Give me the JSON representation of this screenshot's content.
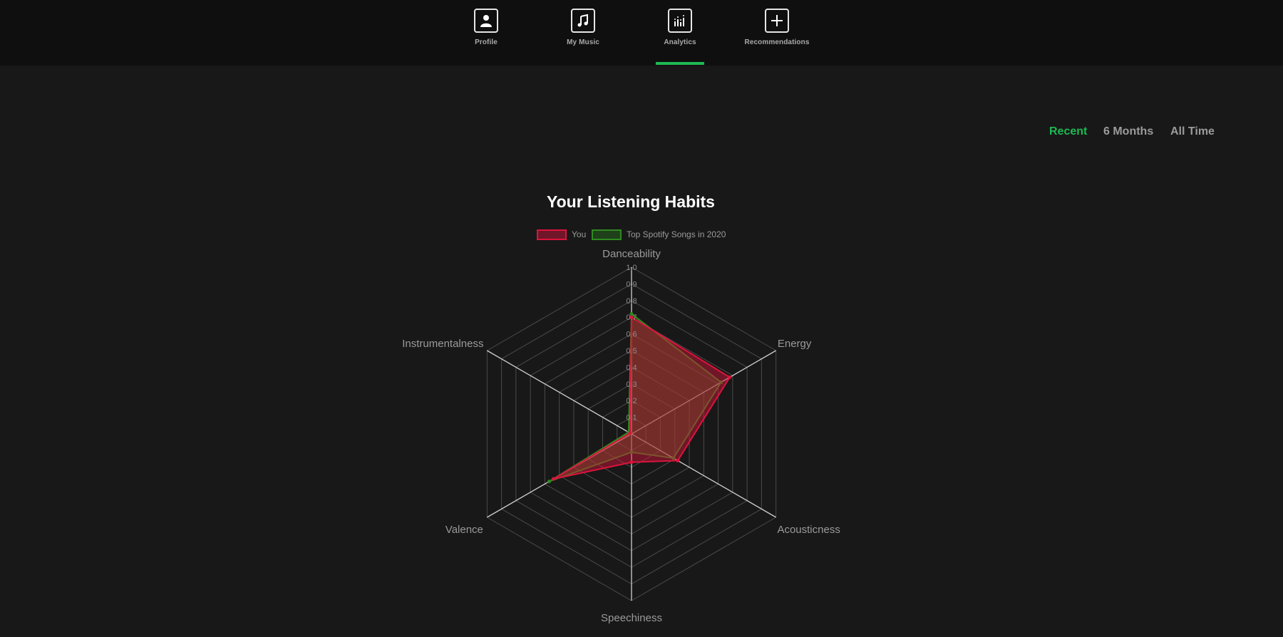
{
  "nav": {
    "items": [
      {
        "label": "Profile",
        "icon": "person-icon"
      },
      {
        "label": "My Music",
        "icon": "music-note-icon"
      },
      {
        "label": "Analytics",
        "icon": "bar-chart-icon",
        "active": true
      },
      {
        "label": "Recommendations",
        "icon": "plus-icon"
      }
    ]
  },
  "range": {
    "tabs": [
      {
        "label": "Recent",
        "active": true
      },
      {
        "label": "6 Months"
      },
      {
        "label": "All Time"
      }
    ]
  },
  "colors": {
    "accent": "#1db954",
    "you": "#dc143c",
    "top": "#2e8b1f",
    "background": "#181818",
    "nav_background": "#0f0f0f"
  },
  "chart_data": {
    "type": "radar",
    "title": "Your Listening Habits",
    "axes": [
      "Danceability",
      "Energy",
      "Acousticness",
      "Speechiness",
      "Valence",
      "Instrumentalness"
    ],
    "ticks": [
      "0.1",
      "0.2",
      "0.3",
      "0.4",
      "0.5",
      "0.6",
      "0.7",
      "0.8",
      "0.9",
      "1.0"
    ],
    "range": [
      0,
      1
    ],
    "legend_position": "top",
    "series": [
      {
        "name": "You",
        "values": [
          0.7,
          0.68,
          0.32,
          0.17,
          0.54,
          0.01
        ]
      },
      {
        "name": "Top Spotify Songs in 2020",
        "values": [
          0.72,
          0.62,
          0.29,
          0.11,
          0.57,
          0.02
        ]
      }
    ]
  }
}
